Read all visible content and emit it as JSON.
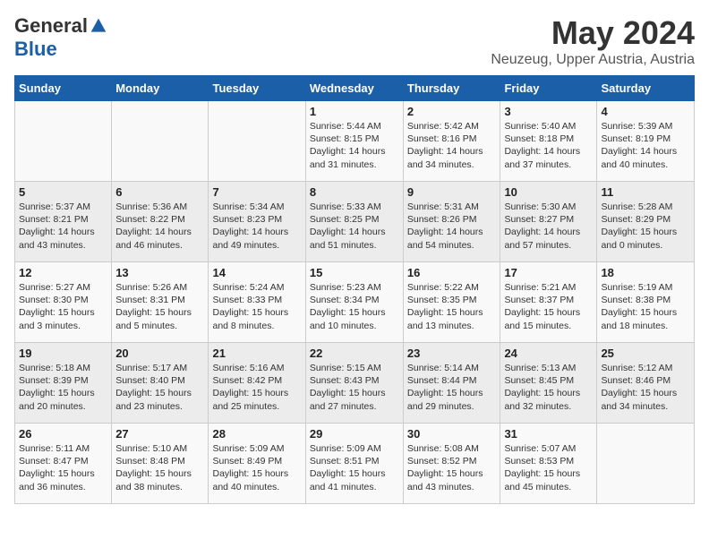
{
  "logo": {
    "general": "General",
    "blue": "Blue"
  },
  "title": "May 2024",
  "location": "Neuzeug, Upper Austria, Austria",
  "weekdays": [
    "Sunday",
    "Monday",
    "Tuesday",
    "Wednesday",
    "Thursday",
    "Friday",
    "Saturday"
  ],
  "weeks": [
    [
      {
        "day": "",
        "info": ""
      },
      {
        "day": "",
        "info": ""
      },
      {
        "day": "",
        "info": ""
      },
      {
        "day": "1",
        "info": "Sunrise: 5:44 AM\nSunset: 8:15 PM\nDaylight: 14 hours\nand 31 minutes."
      },
      {
        "day": "2",
        "info": "Sunrise: 5:42 AM\nSunset: 8:16 PM\nDaylight: 14 hours\nand 34 minutes."
      },
      {
        "day": "3",
        "info": "Sunrise: 5:40 AM\nSunset: 8:18 PM\nDaylight: 14 hours\nand 37 minutes."
      },
      {
        "day": "4",
        "info": "Sunrise: 5:39 AM\nSunset: 8:19 PM\nDaylight: 14 hours\nand 40 minutes."
      }
    ],
    [
      {
        "day": "5",
        "info": "Sunrise: 5:37 AM\nSunset: 8:21 PM\nDaylight: 14 hours\nand 43 minutes."
      },
      {
        "day": "6",
        "info": "Sunrise: 5:36 AM\nSunset: 8:22 PM\nDaylight: 14 hours\nand 46 minutes."
      },
      {
        "day": "7",
        "info": "Sunrise: 5:34 AM\nSunset: 8:23 PM\nDaylight: 14 hours\nand 49 minutes."
      },
      {
        "day": "8",
        "info": "Sunrise: 5:33 AM\nSunset: 8:25 PM\nDaylight: 14 hours\nand 51 minutes."
      },
      {
        "day": "9",
        "info": "Sunrise: 5:31 AM\nSunset: 8:26 PM\nDaylight: 14 hours\nand 54 minutes."
      },
      {
        "day": "10",
        "info": "Sunrise: 5:30 AM\nSunset: 8:27 PM\nDaylight: 14 hours\nand 57 minutes."
      },
      {
        "day": "11",
        "info": "Sunrise: 5:28 AM\nSunset: 8:29 PM\nDaylight: 15 hours\nand 0 minutes."
      }
    ],
    [
      {
        "day": "12",
        "info": "Sunrise: 5:27 AM\nSunset: 8:30 PM\nDaylight: 15 hours\nand 3 minutes."
      },
      {
        "day": "13",
        "info": "Sunrise: 5:26 AM\nSunset: 8:31 PM\nDaylight: 15 hours\nand 5 minutes."
      },
      {
        "day": "14",
        "info": "Sunrise: 5:24 AM\nSunset: 8:33 PM\nDaylight: 15 hours\nand 8 minutes."
      },
      {
        "day": "15",
        "info": "Sunrise: 5:23 AM\nSunset: 8:34 PM\nDaylight: 15 hours\nand 10 minutes."
      },
      {
        "day": "16",
        "info": "Sunrise: 5:22 AM\nSunset: 8:35 PM\nDaylight: 15 hours\nand 13 minutes."
      },
      {
        "day": "17",
        "info": "Sunrise: 5:21 AM\nSunset: 8:37 PM\nDaylight: 15 hours\nand 15 minutes."
      },
      {
        "day": "18",
        "info": "Sunrise: 5:19 AM\nSunset: 8:38 PM\nDaylight: 15 hours\nand 18 minutes."
      }
    ],
    [
      {
        "day": "19",
        "info": "Sunrise: 5:18 AM\nSunset: 8:39 PM\nDaylight: 15 hours\nand 20 minutes."
      },
      {
        "day": "20",
        "info": "Sunrise: 5:17 AM\nSunset: 8:40 PM\nDaylight: 15 hours\nand 23 minutes."
      },
      {
        "day": "21",
        "info": "Sunrise: 5:16 AM\nSunset: 8:42 PM\nDaylight: 15 hours\nand 25 minutes."
      },
      {
        "day": "22",
        "info": "Sunrise: 5:15 AM\nSunset: 8:43 PM\nDaylight: 15 hours\nand 27 minutes."
      },
      {
        "day": "23",
        "info": "Sunrise: 5:14 AM\nSunset: 8:44 PM\nDaylight: 15 hours\nand 29 minutes."
      },
      {
        "day": "24",
        "info": "Sunrise: 5:13 AM\nSunset: 8:45 PM\nDaylight: 15 hours\nand 32 minutes."
      },
      {
        "day": "25",
        "info": "Sunrise: 5:12 AM\nSunset: 8:46 PM\nDaylight: 15 hours\nand 34 minutes."
      }
    ],
    [
      {
        "day": "26",
        "info": "Sunrise: 5:11 AM\nSunset: 8:47 PM\nDaylight: 15 hours\nand 36 minutes."
      },
      {
        "day": "27",
        "info": "Sunrise: 5:10 AM\nSunset: 8:48 PM\nDaylight: 15 hours\nand 38 minutes."
      },
      {
        "day": "28",
        "info": "Sunrise: 5:09 AM\nSunset: 8:49 PM\nDaylight: 15 hours\nand 40 minutes."
      },
      {
        "day": "29",
        "info": "Sunrise: 5:09 AM\nSunset: 8:51 PM\nDaylight: 15 hours\nand 41 minutes."
      },
      {
        "day": "30",
        "info": "Sunrise: 5:08 AM\nSunset: 8:52 PM\nDaylight: 15 hours\nand 43 minutes."
      },
      {
        "day": "31",
        "info": "Sunrise: 5:07 AM\nSunset: 8:53 PM\nDaylight: 15 hours\nand 45 minutes."
      },
      {
        "day": "",
        "info": ""
      }
    ]
  ]
}
